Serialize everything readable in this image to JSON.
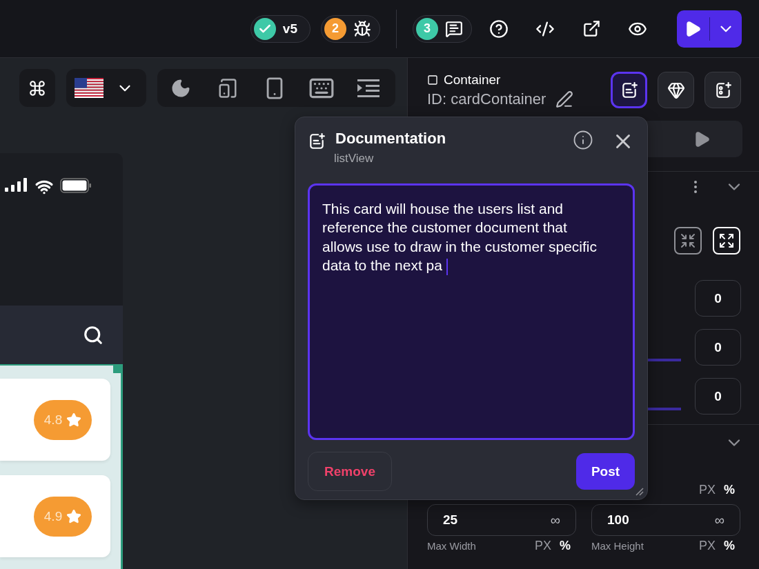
{
  "top_bar": {
    "status_badges": [
      {
        "kind": "version",
        "label": "v5",
        "color": "#3ec9a7"
      },
      {
        "kind": "issues",
        "label": "2",
        "color": "#f59b33"
      }
    ],
    "comments_badge": {
      "label": "3",
      "color": "#3ec9a7"
    }
  },
  "canvas": {
    "list_items": [
      {
        "rating": "4.8"
      },
      {
        "rating": "4.9"
      }
    ]
  },
  "properties": {
    "element_type": "Container",
    "element_id": "ID: cardContainer",
    "panel_tabs": [
      {
        "kind": "docs",
        "selected": true
      },
      {
        "kind": "design",
        "selected": false
      },
      {
        "kind": "add",
        "selected": false
      }
    ],
    "spacing_values": [
      {
        "value": "0",
        "slider": false
      },
      {
        "value": "0",
        "slider": true
      },
      {
        "value": "0",
        "slider": true
      }
    ],
    "size_units": [
      {
        "label": "PX",
        "selected": false
      },
      {
        "label": "%",
        "selected": true
      }
    ],
    "size_fields": [
      {
        "value": "25",
        "suffix": "∞"
      },
      {
        "value": "100",
        "suffix": "∞"
      }
    ],
    "max_fields": [
      {
        "label": "Max Width",
        "units": [
          {
            "label": "PX",
            "selected": false
          },
          {
            "label": "%",
            "selected": true
          }
        ]
      },
      {
        "label": "Max Height",
        "units": [
          {
            "label": "PX",
            "selected": false
          },
          {
            "label": "%",
            "selected": true
          }
        ]
      }
    ]
  },
  "documentation": {
    "title": "Documentation",
    "subtitle": "listView",
    "text": "This card will house the users list and reference the customer document that allows use to draw in the customer specific data to the next pa",
    "remove_label": "Remove",
    "post_label": "Post"
  }
}
